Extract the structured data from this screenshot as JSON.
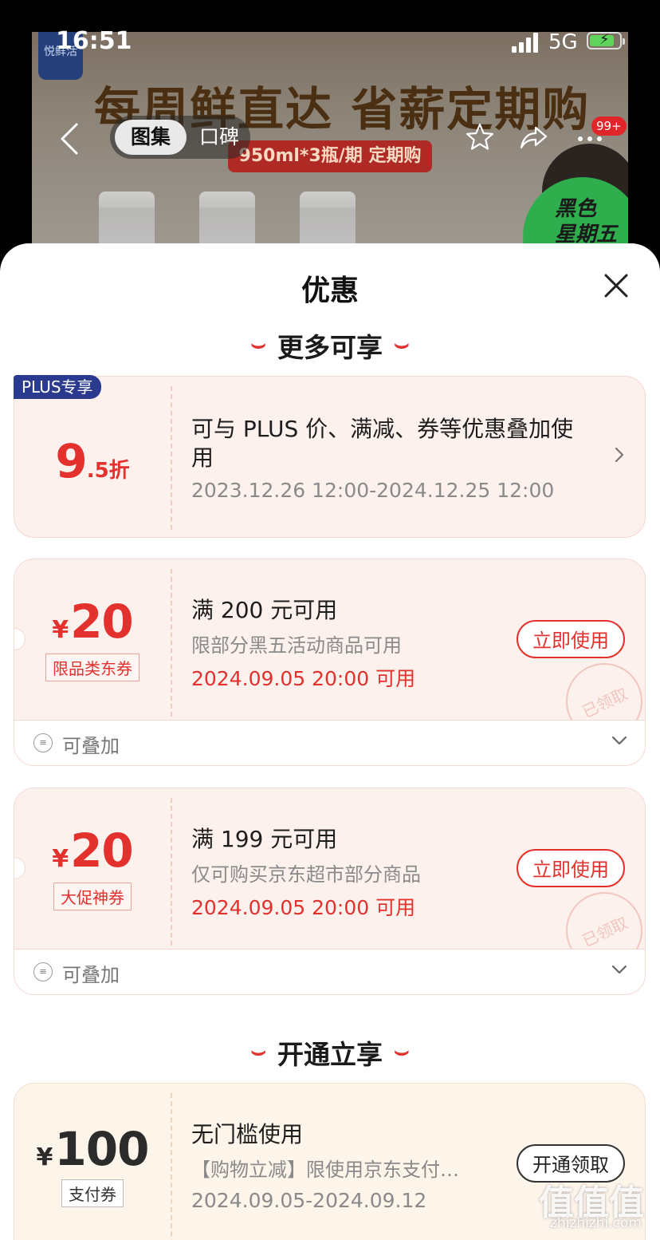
{
  "status_bar": {
    "time": "16:51",
    "network": "5G"
  },
  "product": {
    "banner": "每周鲜直达 省薪定期购",
    "sub_banner": "950ml*3瓶/期 定期购",
    "logo": "悦鲜活",
    "promo": "黑色\n星期五"
  },
  "nav": {
    "tabs": [
      "图集",
      "口碑"
    ],
    "badge": "99+"
  },
  "sheet": {
    "title": "优惠",
    "sections": {
      "more": "更多可享",
      "open": "开通立享"
    }
  },
  "coupons": [
    {
      "badge": "PLUS专享",
      "amount_main": "9",
      "amount_rest": ".5折",
      "condition": "可与 PLUS 价、满减、券等优惠叠加使用",
      "validity": "2023.12.26 12:00-2024.12.25 12:00"
    },
    {
      "currency": "¥",
      "amount": "20",
      "tag": "限品类东券",
      "condition": "满 200 元可用",
      "description": "限部分黑五活动商品可用",
      "validity": "2024.09.05 20:00 可用",
      "button": "立即使用",
      "stamp": "已领取",
      "stack_label": "可叠加"
    },
    {
      "currency": "¥",
      "amount": "20",
      "tag": "大促神券",
      "condition": "满 199 元可用",
      "description": "仅可购买京东超市部分商品",
      "validity": "2024.09.05 20:00 可用",
      "button": "立即使用",
      "stamp": "已领取",
      "stack_label": "可叠加"
    },
    {
      "currency": "¥",
      "amount": "100",
      "tag": "支付券",
      "condition": "无门槛使用",
      "description": "【购物立减】限使用京东支付…",
      "validity": "2024.09.05-2024.09.12",
      "button": "开通领取"
    }
  ],
  "watermark": {
    "main": "值值值",
    "sub": "zhizhizhi.com"
  }
}
